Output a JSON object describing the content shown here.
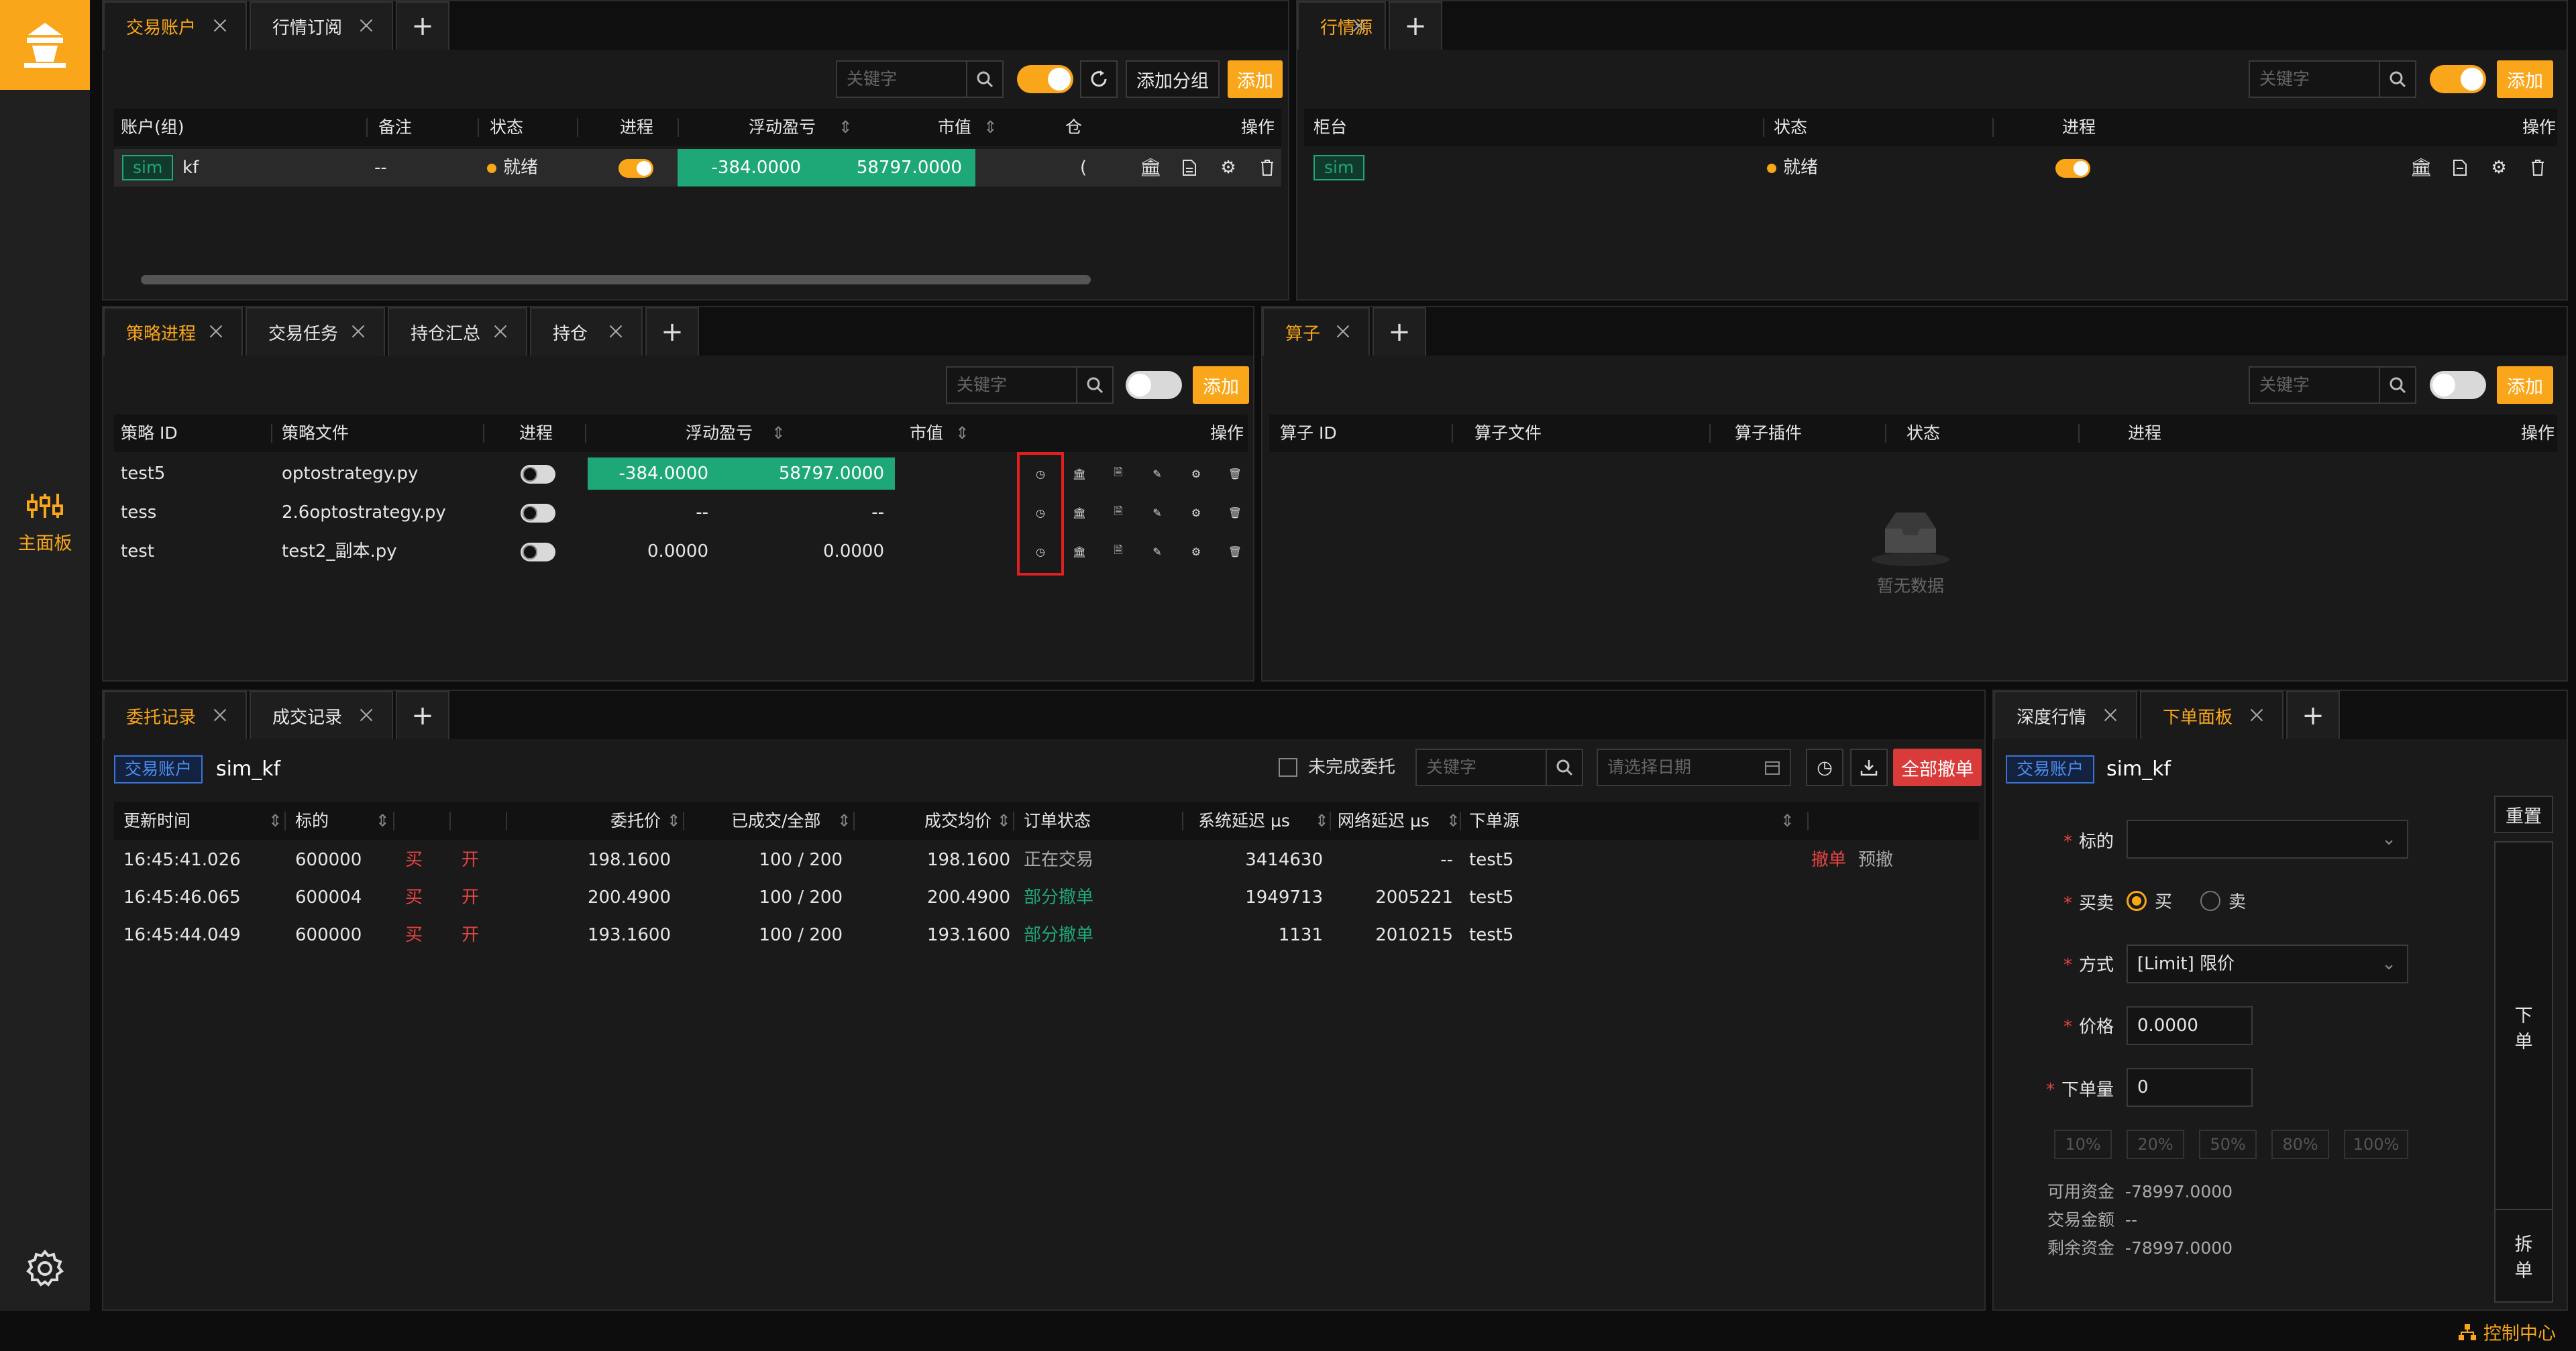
{
  "sidebar": {
    "nav_label": "主面板"
  },
  "footer": {
    "link": "控制中心"
  },
  "p1": {
    "tabs": [
      "交易账户",
      "行情订阅"
    ],
    "search_placeholder": "关键字",
    "add_group": "添加分组",
    "add": "添加",
    "headers": [
      "账户(组)",
      "备注",
      "状态",
      "进程",
      "浮动盈亏",
      "市值",
      "仓",
      "操作"
    ],
    "row": {
      "tag": "sim",
      "name": "kf",
      "note": "--",
      "status": "就绪",
      "pnl": "-384.0000",
      "value": "58797.0000",
      "extra": "("
    }
  },
  "p2": {
    "tabs": [
      "行情源"
    ],
    "search_placeholder": "关键字",
    "add": "添加",
    "headers": [
      "柜台",
      "状态",
      "进程",
      "操作"
    ],
    "row": {
      "tag": "sim",
      "status": "就绪"
    }
  },
  "p3": {
    "tabs": [
      "策略进程",
      "交易任务",
      "持仓汇总",
      "持仓"
    ],
    "search_placeholder": "关键字",
    "add": "添加",
    "headers": [
      "策略 ID",
      "策略文件",
      "进程",
      "浮动盈亏",
      "市值",
      "操作"
    ],
    "rows": [
      {
        "id": "test5",
        "file": "optostrategy.py",
        "pnl": "-384.0000",
        "value": "58797.0000"
      },
      {
        "id": "tess",
        "file": "2.6optostrategy.py",
        "pnl": "--",
        "value": "--"
      },
      {
        "id": "test",
        "file": "test2_副本.py",
        "pnl": "0.0000",
        "value": "0.0000"
      }
    ]
  },
  "p4": {
    "tabs": [
      "算子"
    ],
    "search_placeholder": "关键字",
    "add": "添加",
    "headers": [
      "算子 ID",
      "算子文件",
      "算子插件",
      "状态",
      "进程",
      "操作"
    ],
    "empty": "暂无数据"
  },
  "p5": {
    "tabs": [
      "委托记录",
      "成交记录"
    ],
    "account_tag": "交易账户",
    "account_name": "sim_kf",
    "unfinished_label": "未完成委托",
    "search_placeholder": "关键字",
    "date_placeholder": "请选择日期",
    "cancel_all": "全部撤单",
    "headers": [
      "更新时间",
      "标的",
      "委托价",
      "已成交/全部",
      "成交均价",
      "订单状态",
      "系统延迟 μs",
      "网络延迟 μs",
      "下单源"
    ],
    "rows": [
      {
        "time": "16:45:41.026",
        "symbol": "600000",
        "side": "买",
        "offset": "开",
        "price": "198.1600",
        "filled": "100 / 200",
        "avg": "198.1600",
        "status": "正在交易",
        "sys": "3414630",
        "net": "--",
        "src": "test5",
        "act1": "撤单",
        "act2": "预撤"
      },
      {
        "time": "16:45:46.065",
        "symbol": "600004",
        "side": "买",
        "offset": "开",
        "price": "200.4900",
        "filled": "100 / 200",
        "avg": "200.4900",
        "status": "部分撤单",
        "sys": "1949713",
        "net": "2005221",
        "src": "test5"
      },
      {
        "time": "16:45:44.049",
        "symbol": "600000",
        "side": "买",
        "offset": "开",
        "price": "193.1600",
        "filled": "100 / 200",
        "avg": "193.1600",
        "status": "部分撤单",
        "sys": "1131",
        "net": "2010215",
        "src": "test5"
      }
    ]
  },
  "p6": {
    "tabs": [
      "深度行情",
      "下单面板"
    ],
    "account_tag": "交易账户",
    "account_name": "sim_kf",
    "reset": "重置",
    "labels": {
      "symbol": "标的",
      "side": "买卖",
      "method": "方式",
      "price": "价格",
      "qty": "下单量"
    },
    "side_buy": "买",
    "side_sell": "卖",
    "method_value": "[Limit] 限价",
    "price_value": "0.0000",
    "qty_value": "0",
    "pcts": [
      "10%",
      "20%",
      "50%",
      "80%",
      "100%"
    ],
    "funds": [
      {
        "label": "可用资金",
        "value": "-78997.0000"
      },
      {
        "label": "交易金额",
        "value": "--"
      },
      {
        "label": "剩余资金",
        "value": "-78997.0000"
      }
    ],
    "place_order": "下\n单",
    "split_order": "拆\n单"
  }
}
